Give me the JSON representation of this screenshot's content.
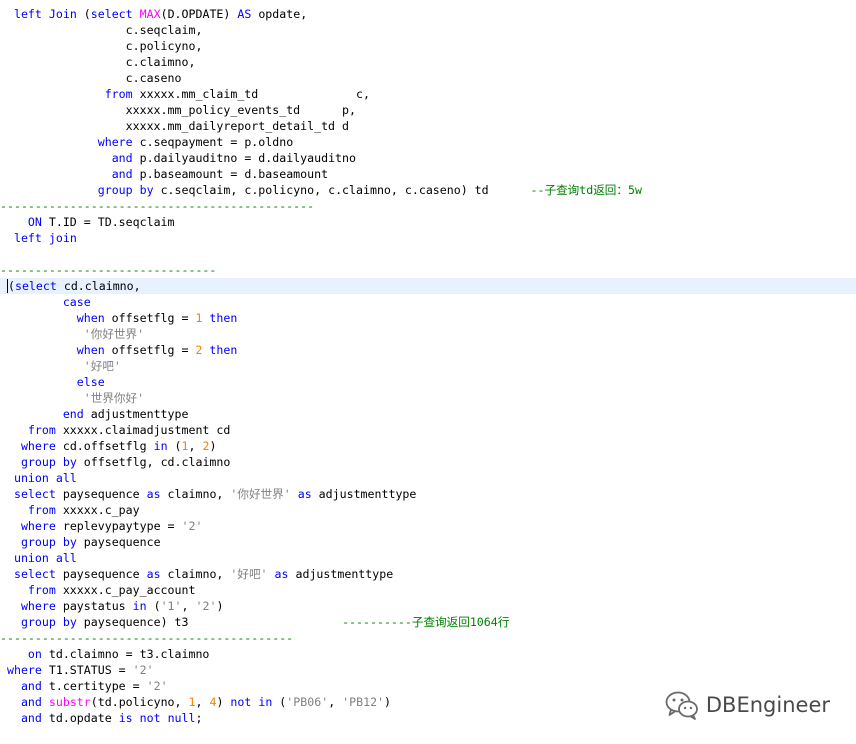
{
  "editor": {
    "current_line": 17,
    "lines": [
      [
        [
          "t",
          "  "
        ],
        [
          "k",
          "left"
        ],
        [
          "t",
          " "
        ],
        [
          "k",
          "Join"
        ],
        [
          "t",
          " ("
        ],
        [
          "k",
          "select"
        ],
        [
          "t",
          " "
        ],
        [
          "f",
          "MAX"
        ],
        [
          "t",
          "(D.OPDATE) "
        ],
        [
          "k",
          "AS"
        ],
        [
          "t",
          " opdate,"
        ]
      ],
      [
        [
          "t",
          "                  c.seqclaim,"
        ]
      ],
      [
        [
          "t",
          "                  c.policyno,"
        ]
      ],
      [
        [
          "t",
          "                  c.claimno,"
        ]
      ],
      [
        [
          "t",
          "                  c.caseno"
        ]
      ],
      [
        [
          "t",
          "               "
        ],
        [
          "k",
          "from"
        ],
        [
          "t",
          " xxxxx.mm_claim_td              c,"
        ]
      ],
      [
        [
          "t",
          "                  xxxxx.mm_policy_events_td      p,"
        ]
      ],
      [
        [
          "t",
          "                  xxxxx.mm_dailyreport_detail_td d"
        ]
      ],
      [
        [
          "t",
          "              "
        ],
        [
          "k",
          "where"
        ],
        [
          "t",
          " c.seqpayment = p.oldno"
        ]
      ],
      [
        [
          "t",
          "                "
        ],
        [
          "k",
          "and"
        ],
        [
          "t",
          " p.dailyauditno = d.dailyauditno"
        ]
      ],
      [
        [
          "t",
          "                "
        ],
        [
          "k",
          "and"
        ],
        [
          "t",
          " p.baseamount = d.baseamount"
        ]
      ],
      [
        [
          "t",
          "              "
        ],
        [
          "k",
          "group"
        ],
        [
          "t",
          " "
        ],
        [
          "k",
          "by"
        ],
        [
          "t",
          " c.seqclaim, c.policyno, c.claimno, c.caseno) td      "
        ],
        [
          "c",
          "--子查询td返回：5w"
        ]
      ],
      [
        [
          "c",
          "---------------------------------------------"
        ]
      ],
      [
        [
          "t",
          "    "
        ],
        [
          "k",
          "ON"
        ],
        [
          "t",
          " T.ID = TD.seqclaim"
        ]
      ],
      [
        [
          "t",
          "  "
        ],
        [
          "k",
          "left"
        ],
        [
          "t",
          " "
        ],
        [
          "k",
          "join"
        ]
      ],
      [
        [
          "t",
          ""
        ]
      ],
      [
        [
          "c",
          "-------------------------------"
        ]
      ],
      [
        [
          "t",
          " "
        ],
        [
          "x",
          "("
        ],
        [
          "k",
          "select"
        ],
        [
          "t",
          " cd.claimno,"
        ]
      ],
      [
        [
          "t",
          "         "
        ],
        [
          "k",
          "case"
        ]
      ],
      [
        [
          "t",
          "           "
        ],
        [
          "k",
          "when"
        ],
        [
          "t",
          " offsetflg = "
        ],
        [
          "n",
          "1"
        ],
        [
          "t",
          " "
        ],
        [
          "k",
          "then"
        ]
      ],
      [
        [
          "t",
          "            "
        ],
        [
          "s",
          "'你好世界'"
        ]
      ],
      [
        [
          "t",
          "           "
        ],
        [
          "k",
          "when"
        ],
        [
          "t",
          " offsetflg = "
        ],
        [
          "n",
          "2"
        ],
        [
          "t",
          " "
        ],
        [
          "k",
          "then"
        ]
      ],
      [
        [
          "t",
          "            "
        ],
        [
          "s",
          "'好吧'"
        ]
      ],
      [
        [
          "t",
          "           "
        ],
        [
          "k",
          "else"
        ]
      ],
      [
        [
          "t",
          "            "
        ],
        [
          "s",
          "'世界你好'"
        ]
      ],
      [
        [
          "t",
          "         "
        ],
        [
          "k",
          "end"
        ],
        [
          "t",
          " adjustmenttype"
        ]
      ],
      [
        [
          "t",
          "    "
        ],
        [
          "k",
          "from"
        ],
        [
          "t",
          " xxxxx.claimadjustment cd"
        ]
      ],
      [
        [
          "t",
          "   "
        ],
        [
          "k",
          "where"
        ],
        [
          "t",
          " cd.offsetflg "
        ],
        [
          "k",
          "in"
        ],
        [
          "t",
          " ("
        ],
        [
          "n",
          "1"
        ],
        [
          "t",
          ", "
        ],
        [
          "n",
          "2"
        ],
        [
          "t",
          ")"
        ]
      ],
      [
        [
          "t",
          "   "
        ],
        [
          "k",
          "group"
        ],
        [
          "t",
          " "
        ],
        [
          "k",
          "by"
        ],
        [
          "t",
          " offsetflg, cd.claimno"
        ]
      ],
      [
        [
          "t",
          "  "
        ],
        [
          "k",
          "union"
        ],
        [
          "t",
          " "
        ],
        [
          "k",
          "all"
        ]
      ],
      [
        [
          "t",
          "  "
        ],
        [
          "k",
          "select"
        ],
        [
          "t",
          " paysequence "
        ],
        [
          "k",
          "as"
        ],
        [
          "t",
          " claimno, "
        ],
        [
          "s",
          "'你好世界'"
        ],
        [
          "t",
          " "
        ],
        [
          "k",
          "as"
        ],
        [
          "t",
          " adjustmenttype"
        ]
      ],
      [
        [
          "t",
          "    "
        ],
        [
          "k",
          "from"
        ],
        [
          "t",
          " xxxxx.c_pay"
        ]
      ],
      [
        [
          "t",
          "   "
        ],
        [
          "k",
          "where"
        ],
        [
          "t",
          " replevypaytype = "
        ],
        [
          "s",
          "'2'"
        ]
      ],
      [
        [
          "t",
          "   "
        ],
        [
          "k",
          "group"
        ],
        [
          "t",
          " "
        ],
        [
          "k",
          "by"
        ],
        [
          "t",
          " paysequence"
        ]
      ],
      [
        [
          "t",
          "  "
        ],
        [
          "k",
          "union"
        ],
        [
          "t",
          " "
        ],
        [
          "k",
          "all"
        ]
      ],
      [
        [
          "t",
          "  "
        ],
        [
          "k",
          "select"
        ],
        [
          "t",
          " paysequence "
        ],
        [
          "k",
          "as"
        ],
        [
          "t",
          " claimno, "
        ],
        [
          "s",
          "'好吧'"
        ],
        [
          "t",
          " "
        ],
        [
          "k",
          "as"
        ],
        [
          "t",
          " adjustmenttype"
        ]
      ],
      [
        [
          "t",
          "    "
        ],
        [
          "k",
          "from"
        ],
        [
          "t",
          " xxxxx.c_pay_account"
        ]
      ],
      [
        [
          "t",
          "   "
        ],
        [
          "k",
          "where"
        ],
        [
          "t",
          " paystatus "
        ],
        [
          "k",
          "in"
        ],
        [
          "t",
          " ("
        ],
        [
          "s",
          "'1'"
        ],
        [
          "t",
          ", "
        ],
        [
          "s",
          "'2'"
        ],
        [
          "t",
          ")"
        ]
      ],
      [
        [
          "t",
          "   "
        ],
        [
          "k",
          "group"
        ],
        [
          "t",
          " "
        ],
        [
          "k",
          "by"
        ],
        [
          "t",
          " paysequence) t3                      "
        ],
        [
          "c",
          "----------子查询返回1064行"
        ]
      ],
      [
        [
          "c",
          "------------------------------------------"
        ]
      ],
      [
        [
          "t",
          "    "
        ],
        [
          "k",
          "on"
        ],
        [
          "t",
          " td.claimno = t3.claimno"
        ]
      ],
      [
        [
          "t",
          " "
        ],
        [
          "k",
          "where"
        ],
        [
          "t",
          " T1.STATUS = "
        ],
        [
          "s",
          "'2'"
        ]
      ],
      [
        [
          "t",
          "   "
        ],
        [
          "k",
          "and"
        ],
        [
          "t",
          " t.certitype = "
        ],
        [
          "s",
          "'2'"
        ]
      ],
      [
        [
          "t",
          "   "
        ],
        [
          "k",
          "and"
        ],
        [
          "t",
          " "
        ],
        [
          "f",
          "substr"
        ],
        [
          "t",
          "(td.policyno, "
        ],
        [
          "n",
          "1"
        ],
        [
          "t",
          ", "
        ],
        [
          "n",
          "4"
        ],
        [
          "t",
          ") "
        ],
        [
          "k",
          "not"
        ],
        [
          "t",
          " "
        ],
        [
          "k",
          "in"
        ],
        [
          "t",
          " ("
        ],
        [
          "s",
          "'PB06'"
        ],
        [
          "t",
          ", "
        ],
        [
          "s",
          "'PB12'"
        ],
        [
          "t",
          ")"
        ]
      ],
      [
        [
          "t",
          "   "
        ],
        [
          "k",
          "and"
        ],
        [
          "t",
          " td.opdate "
        ],
        [
          "k",
          "is"
        ],
        [
          "t",
          " "
        ],
        [
          "k",
          "not"
        ],
        [
          "t",
          " "
        ],
        [
          "k",
          "null"
        ],
        [
          "t",
          ";"
        ]
      ]
    ]
  },
  "colors": {
    "keyword": "#0000ff",
    "function": "#ff00ff",
    "number": "#ff8000",
    "string": "#808080",
    "comment": "#008000",
    "text": "#000000",
    "current_line_bg": "#e8f2fe"
  },
  "watermark": {
    "icon": "wechat-icon",
    "text": "DBEngineer"
  }
}
